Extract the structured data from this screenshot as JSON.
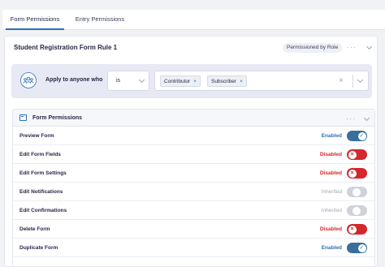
{
  "tabs": [
    {
      "label": "Form Permissions",
      "active": true
    },
    {
      "label": "Entry Permissions",
      "active": false
    }
  ],
  "rule": {
    "title": "Student Registration Form Rule 1",
    "badge": "Permissioned by Role",
    "more_icon": "ellipsis-icon",
    "collapse_icon": "chevron-down-icon"
  },
  "condition": {
    "icon": "users-group-icon",
    "text": "Apply to anyone who",
    "operator": "is",
    "roles": [
      {
        "label": "Contributor",
        "remove": "×"
      },
      {
        "label": "Subscriber",
        "remove": "×"
      }
    ],
    "clear_glyph": "×"
  },
  "permissions": {
    "title": "Form Permissions",
    "icon": "form-icon",
    "items": [
      {
        "label": "Preview Form",
        "status": "Enabled",
        "state": "on"
      },
      {
        "label": "Edit Form Fields",
        "status": "Disabled",
        "state": "off"
      },
      {
        "label": "Edit Form Settings",
        "status": "Disabled",
        "state": "off"
      },
      {
        "label": "Edit Notifications",
        "status": "Inherited",
        "state": "inherit"
      },
      {
        "label": "Edit Confirmations",
        "status": "Inherited",
        "state": "inherit"
      },
      {
        "label": "Delete Form",
        "status": "Disabled",
        "state": "off"
      },
      {
        "label": "Duplicate Form",
        "status": "Enabled",
        "state": "on"
      }
    ]
  },
  "colors": {
    "enabled": "#2d6fb7",
    "enabled_toggle": "#3a6f9c",
    "disabled": "#d4272d",
    "inherited_text": "#a3a8b8",
    "inherited_toggle": "#cfd2db",
    "accent": "#2d6fb7"
  }
}
